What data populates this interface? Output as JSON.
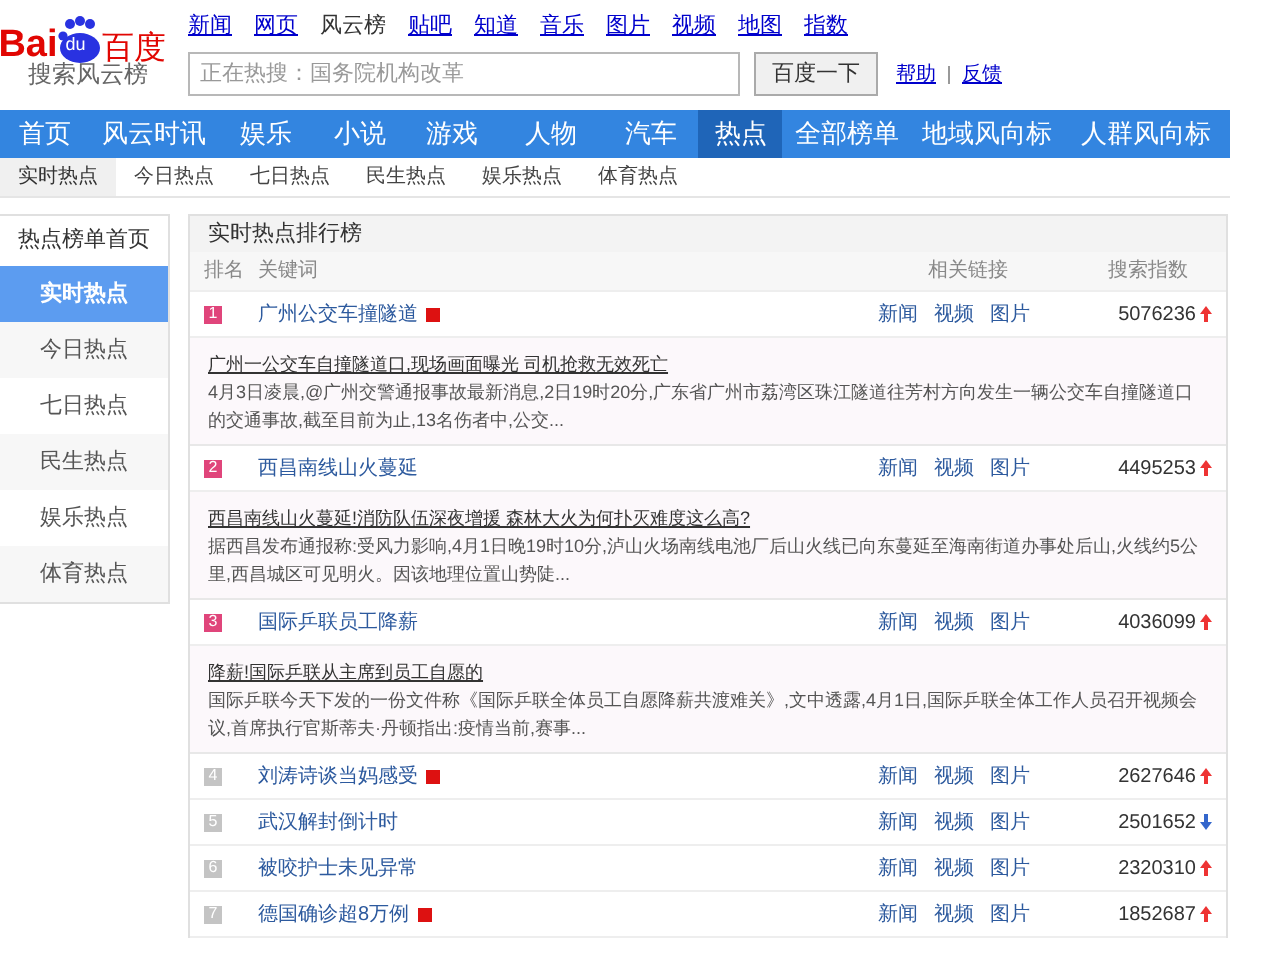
{
  "logo": {
    "wordmark": [
      "Bai",
      "du",
      "百度"
    ],
    "subtitle": "搜索风云榜"
  },
  "top_links": [
    {
      "label": "新闻",
      "selected": false
    },
    {
      "label": "网页",
      "selected": false
    },
    {
      "label": "风云榜",
      "selected": true
    },
    {
      "label": "贴吧",
      "selected": false
    },
    {
      "label": "知道",
      "selected": false
    },
    {
      "label": "音乐",
      "selected": false
    },
    {
      "label": "图片",
      "selected": false
    },
    {
      "label": "视频",
      "selected": false
    },
    {
      "label": "地图",
      "selected": false
    },
    {
      "label": "指数",
      "selected": false
    }
  ],
  "search": {
    "placeholder": "正在热搜：国务院机构改革",
    "button": "百度一下",
    "links": [
      "帮助",
      "反馈"
    ]
  },
  "nav": [
    {
      "label": "首页",
      "selected": false
    },
    {
      "label": "风云时讯",
      "selected": false
    },
    {
      "label": "娱乐",
      "selected": false
    },
    {
      "label": "小说",
      "selected": false
    },
    {
      "label": "游戏",
      "selected": false
    },
    {
      "label": "人物",
      "selected": false
    },
    {
      "label": "汽车",
      "selected": false
    },
    {
      "label": "热点",
      "selected": true
    },
    {
      "label": "全部榜单",
      "selected": false
    },
    {
      "label": "地域风向标",
      "selected": false
    },
    {
      "label": "人群风向标",
      "selected": false
    }
  ],
  "subnav": [
    {
      "label": "实时热点",
      "selected": true
    },
    {
      "label": "今日热点",
      "selected": false
    },
    {
      "label": "七日热点",
      "selected": false
    },
    {
      "label": "民生热点",
      "selected": false
    },
    {
      "label": "娱乐热点",
      "selected": false
    },
    {
      "label": "体育热点",
      "selected": false
    }
  ],
  "sidebar": {
    "title": "热点榜单首页",
    "items": [
      {
        "label": "实时热点",
        "selected": true
      },
      {
        "label": "今日热点",
        "selected": false
      },
      {
        "label": "七日热点",
        "selected": false
      },
      {
        "label": "民生热点",
        "selected": false
      },
      {
        "label": "娱乐热点",
        "selected": false
      },
      {
        "label": "体育热点",
        "selected": false
      }
    ]
  },
  "ranking": {
    "title": "实时热点排行榜",
    "columns": [
      "排名",
      "关键词",
      "相关链接",
      "搜索指数"
    ],
    "rows": [
      {
        "rank": "1",
        "keyword": "广州公交车撞隧道",
        "new": true,
        "links": [
          "新闻",
          "视频",
          "图片"
        ],
        "index": "5076236",
        "rising": true,
        "detail": {
          "headline": "广州一公交车自撞隧道口,现场画面曝光 司机抢救无效死亡",
          "summary": "4月3日凌晨,@广州交警通报事故最新消息,2日19时20分,广东省广州市荔湾区珠江隧道往芳村方向发生一辆公交车自撞隧道口的交通事故,截至目前为止,13名伤者中,公交..."
        }
      },
      {
        "rank": "2",
        "keyword": "西昌南线山火蔓延",
        "new": false,
        "links": [
          "新闻",
          "视频",
          "图片"
        ],
        "index": "4495253",
        "rising": true,
        "detail": {
          "headline": "西昌南线山火蔓延!消防队伍深夜增援 森林大火为何扑灭难度这么高?",
          "summary": "据西昌发布通报称:受风力影响,4月1日晚19时10分,泸山火场南线电池厂后山火线已向东蔓延至海南街道办事处后山,火线约5公里,西昌城区可见明火。因该地理位置山势陡..."
        }
      },
      {
        "rank": "3",
        "keyword": "国际乒联员工降薪",
        "new": false,
        "links": [
          "新闻",
          "视频",
          "图片"
        ],
        "index": "4036099",
        "rising": true,
        "detail": {
          "headline": "降薪!国际乒联从主席到员工自愿的",
          "summary": "国际乒联今天下发的一份文件称《国际乒联全体员工自愿降薪共渡难关》,文中透露,4月1日,国际乒联全体工作人员召开视频会议,首席执行官斯蒂夫·丹顿指出:疫情当前,赛事..."
        }
      },
      {
        "rank": "4",
        "keyword": "刘涛诗谈当妈感受",
        "new": true,
        "links": [
          "新闻",
          "视频",
          "图片"
        ],
        "index": "2627646",
        "rising": true
      },
      {
        "rank": "5",
        "keyword": "武汉解封倒计时",
        "new": false,
        "links": [
          "新闻",
          "视频",
          "图片"
        ],
        "index": "2501652",
        "rising": false
      },
      {
        "rank": "6",
        "keyword": "被咬护士未见异常",
        "new": false,
        "links": [
          "新闻",
          "视频",
          "图片"
        ],
        "index": "2320310",
        "rising": true
      },
      {
        "rank": "7",
        "keyword": "德国确诊超8万例",
        "new": true,
        "links": [
          "新闻",
          "视频",
          "图片"
        ],
        "index": "1852687",
        "rising": true
      }
    ]
  }
}
